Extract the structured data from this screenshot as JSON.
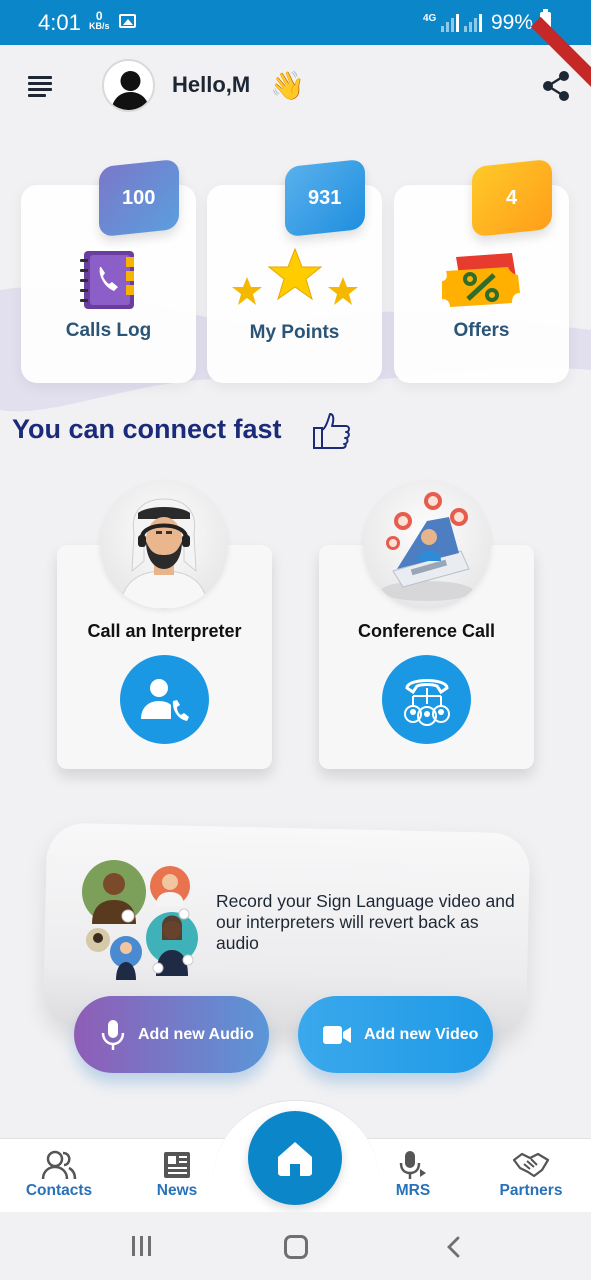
{
  "status_bar": {
    "time": "4:01",
    "data_rate_value": "0",
    "data_rate_unit": "KB/s",
    "network": "4G",
    "battery": "99%"
  },
  "header": {
    "greeting": "Hello,M",
    "wave_emoji": "👋"
  },
  "stats": [
    {
      "value": "100",
      "label": "Calls Log",
      "color_from": "#7a78c9",
      "color_to": "#5b9ede"
    },
    {
      "value": "931",
      "label": "My Points",
      "color_from": "#5ab0ec",
      "color_to": "#1f8fdf"
    },
    {
      "value": "4",
      "label": "Offers",
      "color_from": "#ffc928",
      "color_to": "#ff9e1a"
    }
  ],
  "connect": {
    "title": "You can connect fast",
    "services": [
      {
        "title": "Call an Interpreter"
      },
      {
        "title": "Conference Call"
      }
    ]
  },
  "record": {
    "text": "Record your Sign Language video and our interpreters will revert back as audio",
    "audio_label": "Add new Audio",
    "video_label": "Add new Video"
  },
  "bottom_nav": {
    "items": [
      {
        "label": "Contacts"
      },
      {
        "label": "News"
      },
      {
        "label": "MRS"
      },
      {
        "label": "Partners"
      }
    ]
  },
  "colors": {
    "accent": "#0b86c9",
    "primary_button": "#1a98e4",
    "title": "#1b2a79",
    "nav_text": "#2a72b8"
  }
}
